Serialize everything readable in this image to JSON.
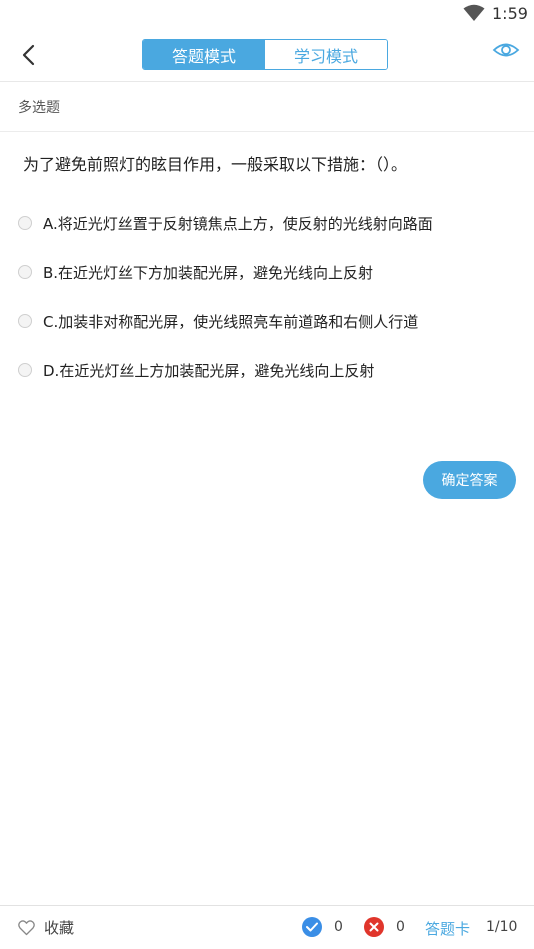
{
  "status_bar": {
    "time": "1:59",
    "icons": [
      "wifi-icon"
    ]
  },
  "header": {
    "back_icon": "chevron-left-icon",
    "tabs": [
      {
        "label": "答题模式",
        "active": true
      },
      {
        "label": "学习模式",
        "active": false
      }
    ],
    "eye_icon": "eye-icon",
    "accent_color": "#4aa8e0"
  },
  "question": {
    "type": "多选题",
    "text": "为了避免前照灯的眩目作用，一般采取以下措施：（）。",
    "options": [
      "A.将近光灯丝置于反射镜焦点上方，使反射的光线射向路面",
      "B.在近光灯丝下方加装配光屏，避免光线向上反射",
      "C.加装非对称配光屏，使光线照亮车前道路和右侧人行道",
      "D.在近光灯丝上方加装配光屏，避免光线向上反射"
    ],
    "confirm_label": "确定答案"
  },
  "bottom_bar": {
    "favorite_label": "收藏",
    "favorite_icon": "heart-outline-icon",
    "correct_count": "0",
    "correct_icon": "check-circle-icon",
    "correct_color": "#3a8ee6",
    "wrong_count": "0",
    "wrong_icon": "x-circle-icon",
    "wrong_color": "#e0352b",
    "answer_card_label": "答题卡",
    "progress": "1/10"
  }
}
